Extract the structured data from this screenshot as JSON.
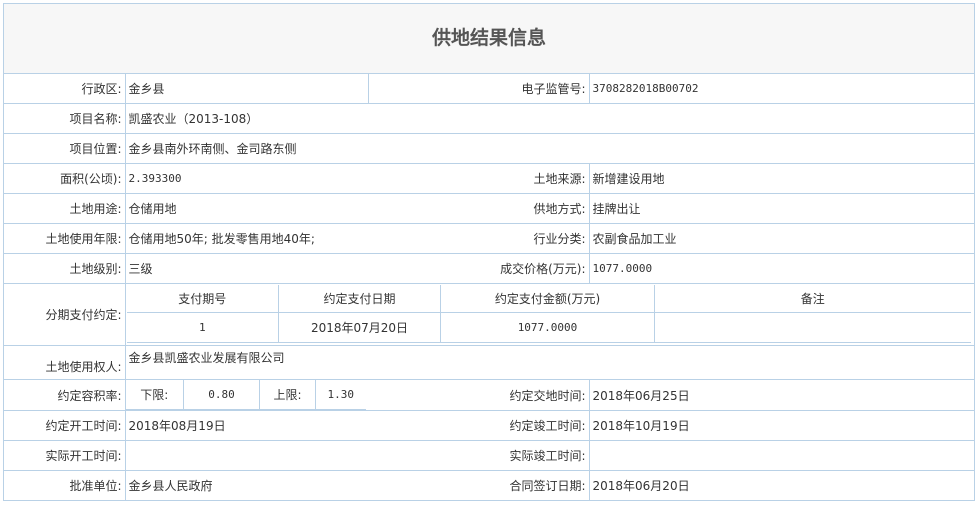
{
  "title": "供地结果信息",
  "rows": {
    "district_label": "行政区:",
    "district": "金乡县",
    "supervision_no_label": "电子监管号:",
    "supervision_no": "3708282018B00702",
    "project_name_label": "项目名称:",
    "project_name": "凯盛农业（2013-108）",
    "project_location_label": "项目位置:",
    "project_location": "金乡县南外环南侧、金司路东侧",
    "area_label": "面积(公顷):",
    "area": "2.393300",
    "land_source_label": "土地来源:",
    "land_source": "新增建设用地",
    "land_use_label": "土地用途:",
    "land_use": "仓储用地",
    "supply_method_label": "供地方式:",
    "supply_method": "挂牌出让",
    "use_term_label": "土地使用年限:",
    "use_term": "仓储用地50年; 批发零售用地40年;",
    "industry_label": "行业分类:",
    "industry": "农副食品加工业",
    "land_grade_label": "土地级别:",
    "land_grade": "三级",
    "price_label": "成交价格(万元):",
    "price": "1077.0000",
    "installment_label": "分期支付约定:",
    "installment_headers": [
      "支付期号",
      "约定支付日期",
      "约定支付金额(万元)",
      "备注"
    ],
    "installment_rows": [
      [
        "1",
        "2018年07月20日",
        "1077.0000",
        ""
      ]
    ],
    "owner_label": "土地使用权人:",
    "owner": "金乡县凯盛农业发展有限公司",
    "far_label": "约定容积率:",
    "far_lower_label": "下限:",
    "far_lower": "0.80",
    "far_upper_label": "上限:",
    "far_upper": "1.30",
    "delivery_time_label": "约定交地时间:",
    "delivery_time": "2018年06月25日",
    "start_time_label": "约定开工时间:",
    "start_time": "2018年08月19日",
    "finish_time_label": "约定竣工时间:",
    "finish_time": "2018年10月19日",
    "actual_start_label": "实际开工时间:",
    "actual_start": "",
    "actual_finish_label": "实际竣工时间:",
    "actual_finish": "",
    "approver_label": "批准单位:",
    "approver": "金乡县人民政府",
    "contract_date_label": "合同签订日期:",
    "contract_date": "2018年06月20日"
  }
}
